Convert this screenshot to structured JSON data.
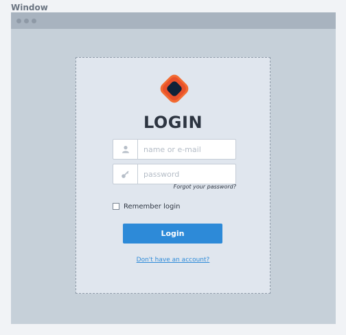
{
  "window": {
    "label": "Window"
  },
  "login": {
    "title": "LOGIN",
    "username_placeholder": "name or e-mail",
    "username_value": "",
    "password_placeholder": "password",
    "password_value": "",
    "forgot_password": "Forgot your password?",
    "remember_label": "Remember login",
    "remember_checked": false,
    "button_label": "Login",
    "signup_link": "Don't have an account?"
  },
  "icons": {
    "logo": "brand-logo",
    "user": "user-icon",
    "key": "key-icon"
  },
  "colors": {
    "accent": "#2d8ad8",
    "logo_orange": "#f0652e",
    "logo_dark": "#0f2238",
    "title": "#2d3541"
  }
}
